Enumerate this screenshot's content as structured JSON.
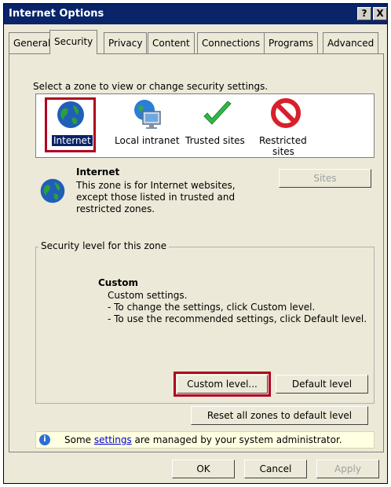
{
  "window": {
    "title": "Internet Options",
    "help_btn": "?",
    "close_btn": "X"
  },
  "tabs": [
    "General",
    "Security",
    "Privacy",
    "Content",
    "Connections",
    "Programs",
    "Advanced"
  ],
  "active_tab": "Security",
  "zone_prompt": "Select a zone to view or change security settings.",
  "zones": [
    {
      "label": "Internet",
      "icon": "globe-icon",
      "selected": true
    },
    {
      "label": "Local intranet",
      "icon": "local-intranet-icon"
    },
    {
      "label": "Trusted sites",
      "icon": "checkmark-icon"
    },
    {
      "label": "Restricted sites",
      "label_line1": "Restricted",
      "label_line2": "sites",
      "icon": "restricted-icon"
    }
  ],
  "zone_info": {
    "heading": "Internet",
    "lines": [
      "This zone is for Internet websites,",
      "except those listed in trusted and",
      "restricted zones."
    ],
    "sites_button": "Sites"
  },
  "security_level": {
    "group_title": "Security level for this zone",
    "level_name": "Custom",
    "desc_lines": [
      "Custom settings.",
      "- To change the settings, click Custom level.",
      "- To use the recommended settings, click Default level."
    ],
    "custom_level_button": "Custom level...",
    "default_level_button": "Default level"
  },
  "reset_button": "Reset all zones to default level",
  "infobar": {
    "before": "Some ",
    "link": "settings",
    "after": " are managed by your system administrator."
  },
  "footer": {
    "ok": "OK",
    "cancel": "Cancel",
    "apply": "Apply"
  },
  "colors": {
    "title_bar": "#0a246a",
    "highlight": "#b00020",
    "infobar_bg": "#ffffe1"
  }
}
